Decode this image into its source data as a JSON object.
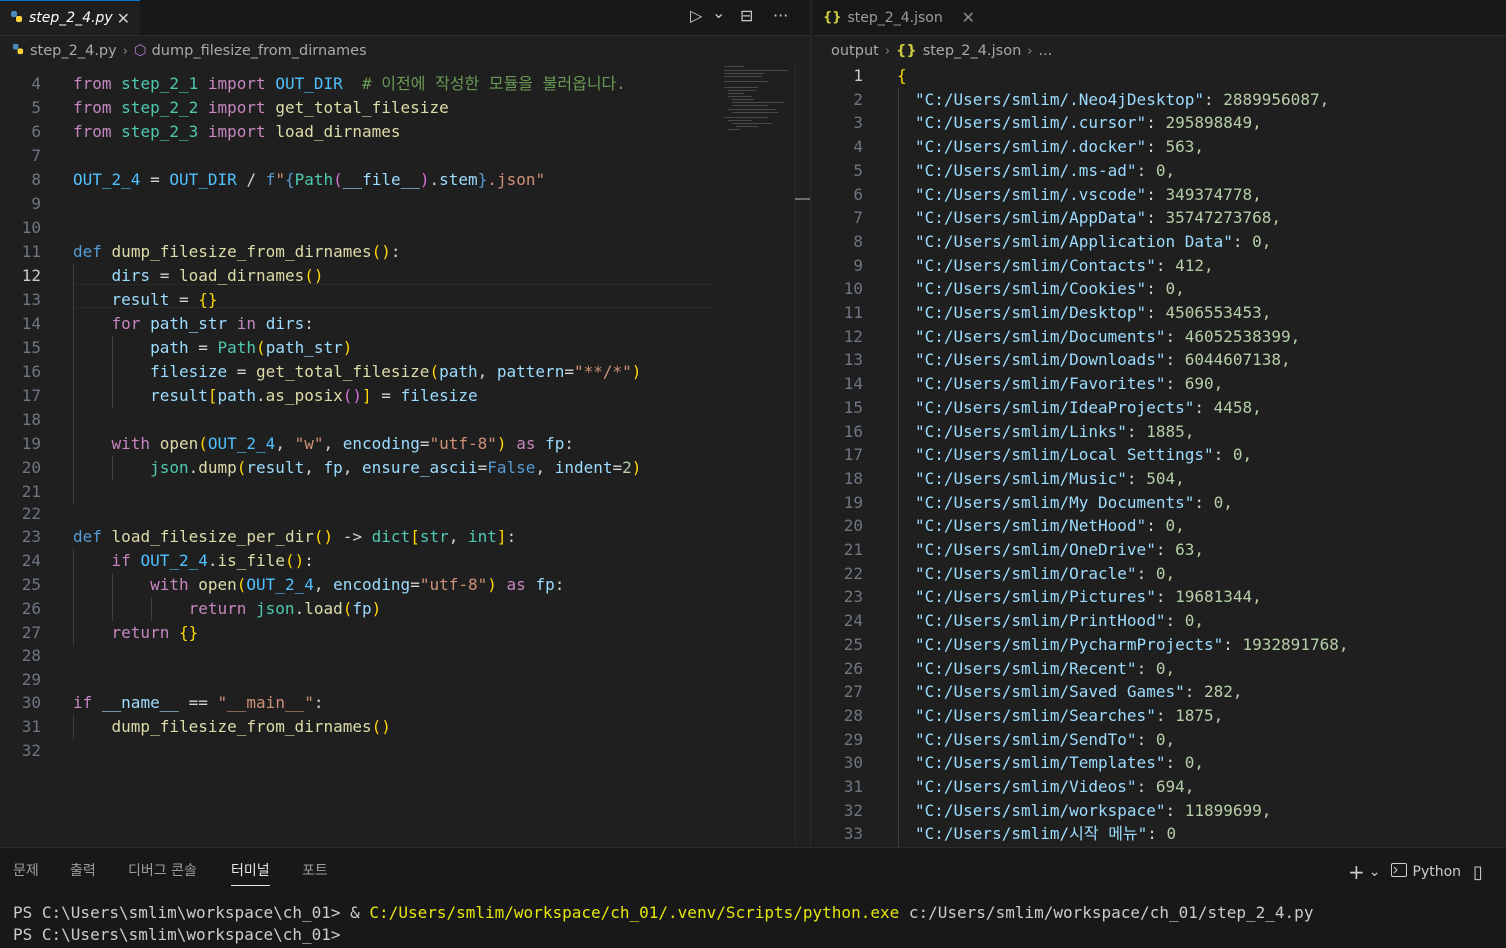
{
  "left_tab": {
    "label": "step_2_4.py",
    "close": "✕"
  },
  "right_tab": {
    "label": "step_2_4.json",
    "icon": "{}",
    "close": "✕"
  },
  "toolbar": {
    "run": "▷",
    "run_menu": "⌄",
    "split": "⊟",
    "more": "···"
  },
  "left_breadcrumb": {
    "file": "step_2_4.py",
    "symbol": "dump_filesize_from_dirnames"
  },
  "right_breadcrumb": {
    "folder": "output",
    "file": "step_2_4.json",
    "more": "..."
  },
  "left_editor": {
    "line_numbers": [
      "4",
      "5",
      "6",
      "7",
      "8",
      "9",
      "10",
      "11",
      "12",
      "13",
      "14",
      "15",
      "16",
      "17",
      "18",
      "19",
      "20",
      "21",
      "22",
      "23",
      "24",
      "25",
      "26",
      "27",
      "28",
      "29",
      "30",
      "31",
      "32"
    ],
    "active_line": "12"
  },
  "right_editor": {
    "line_numbers": [
      "1",
      "2",
      "3",
      "4",
      "5",
      "6",
      "7",
      "8",
      "9",
      "10",
      "11",
      "12",
      "13",
      "14",
      "15",
      "16",
      "17",
      "18",
      "19",
      "20",
      "21",
      "22",
      "23",
      "24",
      "25",
      "26",
      "27",
      "28",
      "29",
      "30",
      "31",
      "32",
      "33"
    ],
    "open_brace": "{",
    "entries": [
      {
        "key": "\"C:/Users/smlim/.Neo4jDesktop\"",
        "value": "2889956087,"
      },
      {
        "key": "\"C:/Users/smlim/.cursor\"",
        "value": "295898849,"
      },
      {
        "key": "\"C:/Users/smlim/.docker\"",
        "value": "563,"
      },
      {
        "key": "\"C:/Users/smlim/.ms-ad\"",
        "value": "0,"
      },
      {
        "key": "\"C:/Users/smlim/.vscode\"",
        "value": "349374778,"
      },
      {
        "key": "\"C:/Users/smlim/AppData\"",
        "value": "35747273768,"
      },
      {
        "key": "\"C:/Users/smlim/Application Data\"",
        "value": "0,"
      },
      {
        "key": "\"C:/Users/smlim/Contacts\"",
        "value": "412,"
      },
      {
        "key": "\"C:/Users/smlim/Cookies\"",
        "value": "0,"
      },
      {
        "key": "\"C:/Users/smlim/Desktop\"",
        "value": "4506553453,"
      },
      {
        "key": "\"C:/Users/smlim/Documents\"",
        "value": "46052538399,"
      },
      {
        "key": "\"C:/Users/smlim/Downloads\"",
        "value": "6044607138,"
      },
      {
        "key": "\"C:/Users/smlim/Favorites\"",
        "value": "690,"
      },
      {
        "key": "\"C:/Users/smlim/IdeaProjects\"",
        "value": "4458,"
      },
      {
        "key": "\"C:/Users/smlim/Links\"",
        "value": "1885,"
      },
      {
        "key": "\"C:/Users/smlim/Local Settings\"",
        "value": "0,"
      },
      {
        "key": "\"C:/Users/smlim/Music\"",
        "value": "504,"
      },
      {
        "key": "\"C:/Users/smlim/My Documents\"",
        "value": "0,"
      },
      {
        "key": "\"C:/Users/smlim/NetHood\"",
        "value": "0,"
      },
      {
        "key": "\"C:/Users/smlim/OneDrive\"",
        "value": "63,"
      },
      {
        "key": "\"C:/Users/smlim/Oracle\"",
        "value": "0,"
      },
      {
        "key": "\"C:/Users/smlim/Pictures\"",
        "value": "19681344,"
      },
      {
        "key": "\"C:/Users/smlim/PrintHood\"",
        "value": "0,"
      },
      {
        "key": "\"C:/Users/smlim/PycharmProjects\"",
        "value": "1932891768,"
      },
      {
        "key": "\"C:/Users/smlim/Recent\"",
        "value": "0,"
      },
      {
        "key": "\"C:/Users/smlim/Saved Games\"",
        "value": "282,"
      },
      {
        "key": "\"C:/Users/smlim/Searches\"",
        "value": "1875,"
      },
      {
        "key": "\"C:/Users/smlim/SendTo\"",
        "value": "0,"
      },
      {
        "key": "\"C:/Users/smlim/Templates\"",
        "value": "0,"
      },
      {
        "key": "\"C:/Users/smlim/Videos\"",
        "value": "694,"
      },
      {
        "key": "\"C:/Users/smlim/workspace\"",
        "value": "11899699,"
      },
      {
        "key": "\"C:/Users/smlim/시작 메뉴\"",
        "value": "0"
      }
    ]
  },
  "panel": {
    "tabs": [
      "문제",
      "출력",
      "디버그 콘솔",
      "터미널",
      "포트"
    ],
    "active_tab": "터미널",
    "add": "+",
    "add_menu": "⌄",
    "shell": "Python",
    "layout": "▯",
    "terminal": {
      "line1_prompt": "PS C:\\Users\\smlim\\workspace\\ch_01> & ",
      "line1_exe": "C:/Users/smlim/workspace/ch_01/.venv/Scripts/python.exe",
      "line1_arg": " c:/Users/smlim/workspace/ch_01/step_2_4.py",
      "line2_prompt": "PS C:\\Users\\smlim\\workspace\\ch_01>"
    }
  },
  "colors": {
    "accent": "#0078d4",
    "background": "#1f1f1f",
    "keyword": "#569cd6",
    "string": "#ce9178",
    "number": "#b5cea8"
  }
}
